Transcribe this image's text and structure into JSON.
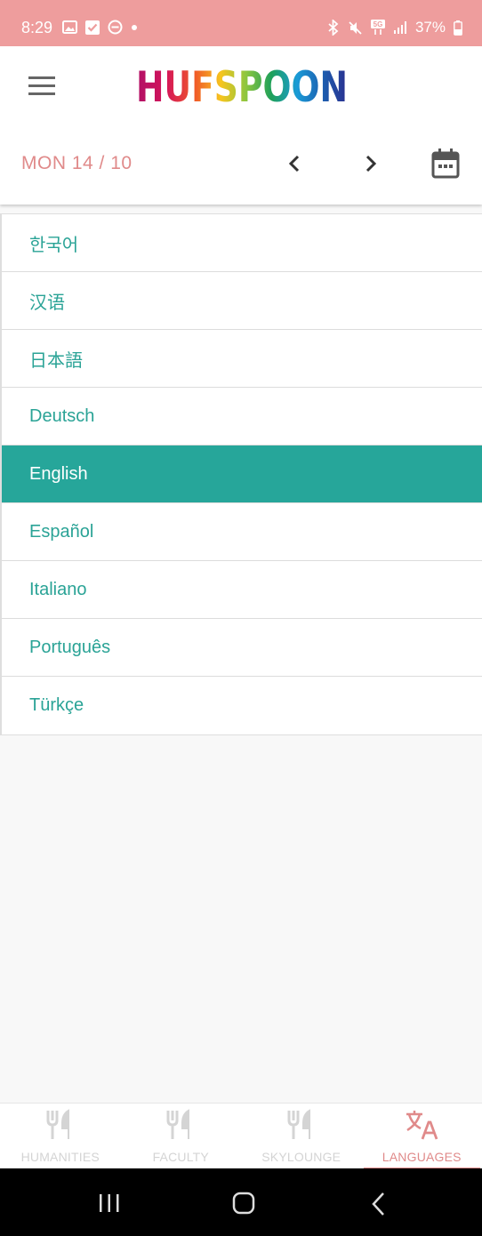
{
  "status_bar": {
    "time": "8:29",
    "battery": "37%",
    "network": "5G"
  },
  "header": {
    "logo_text": "HUFSPOON",
    "date_label": "MON  14 / 10"
  },
  "languages": {
    "selected": "English",
    "items": [
      {
        "label": "한국어"
      },
      {
        "label": "汉语"
      },
      {
        "label": "日本語"
      },
      {
        "label": "Deutsch"
      },
      {
        "label": "English"
      },
      {
        "label": "Español"
      },
      {
        "label": "Italiano"
      },
      {
        "label": "Português"
      },
      {
        "label": "Türkçe"
      }
    ]
  },
  "bottom_tabs": [
    {
      "label": "HUMANITIES",
      "icon": "fork-knife-icon"
    },
    {
      "label": "FACULTY",
      "icon": "fork-knife-icon"
    },
    {
      "label": "SKYLOUNGE",
      "icon": "fork-knife-icon"
    },
    {
      "label": "LANGUAGES",
      "icon": "translate-icon"
    }
  ],
  "colors": {
    "accent_pink": "#e08a8a",
    "status_bar": "#ee9d9d",
    "teal": "#26a69a",
    "teal_text": "#2aa396"
  }
}
